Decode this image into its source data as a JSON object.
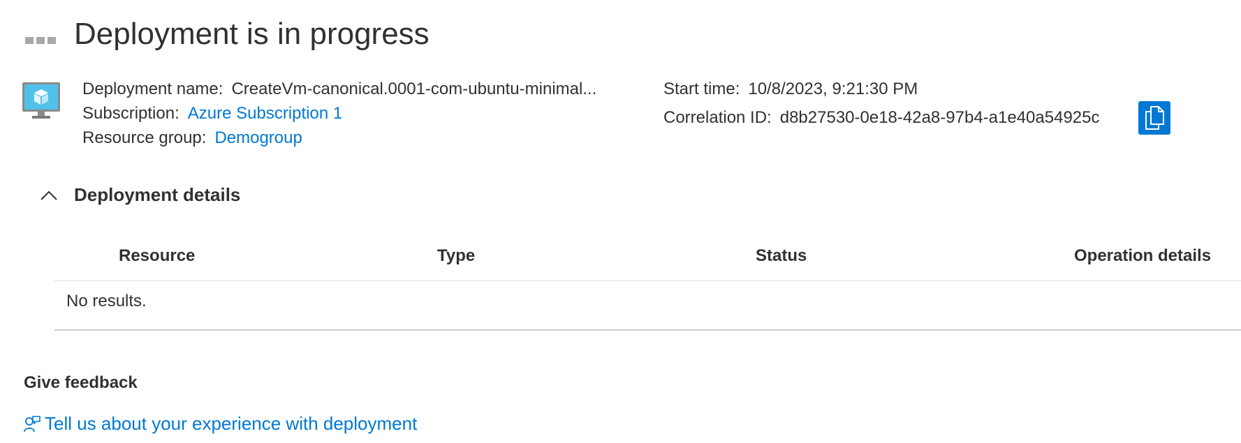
{
  "header": {
    "title": "Deployment is in progress",
    "status_icon": "in-progress-dots-icon"
  },
  "deployment": {
    "name_label": "Deployment name:",
    "name_value": "CreateVm-canonical.0001-com-ubuntu-minimal...",
    "subscription_label": "Subscription:",
    "subscription_value": "Azure Subscription 1",
    "resource_group_label": "Resource group:",
    "resource_group_value": "Demogroup",
    "start_time_label": "Start time:",
    "start_time_value": "10/8/2023, 9:21:30 PM",
    "correlation_label": "Correlation ID:",
    "correlation_value": "d8b27530-0e18-42a8-97b4-a1e40a54925c",
    "icon": "virtual-machine-icon",
    "copy_icon": "copy-icon"
  },
  "details": {
    "title": "Deployment details",
    "columns": [
      "Resource",
      "Type",
      "Status",
      "Operation details"
    ],
    "empty_text": "No results."
  },
  "feedback": {
    "title": "Give feedback",
    "link": "Tell us about your experience with deployment",
    "icon": "feedback-icon"
  },
  "colors": {
    "link": "#0078d4",
    "text": "#323130",
    "accent_button": "#0078d4",
    "divider": "#e1dfdd"
  }
}
